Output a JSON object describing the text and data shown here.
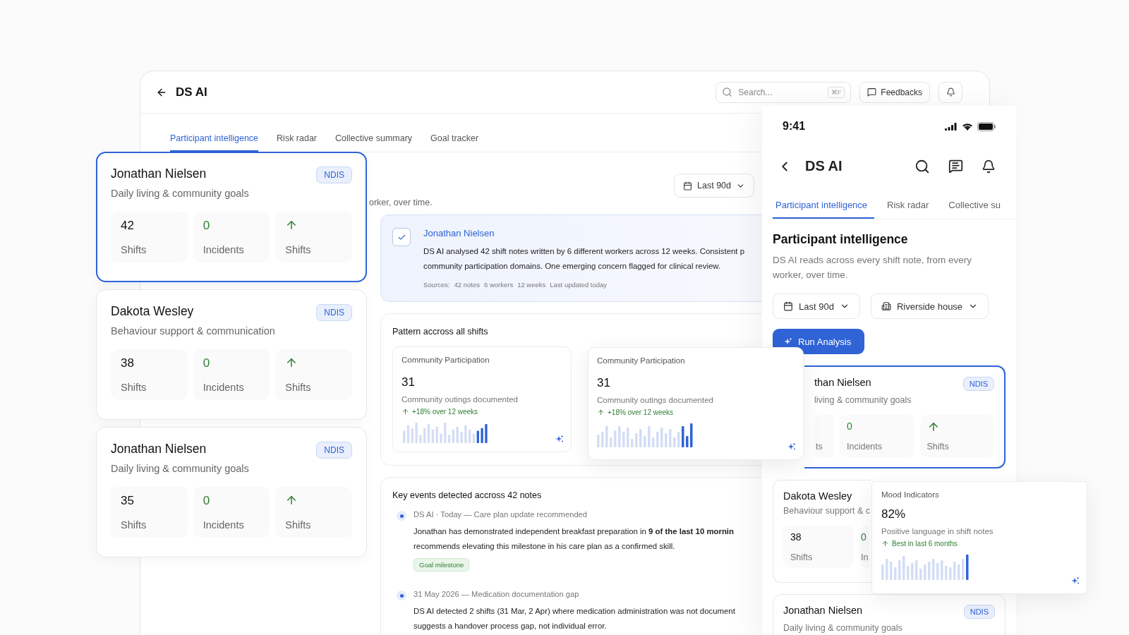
{
  "window": {
    "title": "DS AI",
    "search": {
      "placeholder": "Search...",
      "shortcut": "⌘F"
    },
    "feedback_button": "Feedbacks"
  },
  "tabs": [
    {
      "label": "Participant intelligence",
      "selected": true
    },
    {
      "label": "Risk radar",
      "selected": false
    },
    {
      "label": "Collective summary",
      "selected": false
    },
    {
      "label": "Goal tracker",
      "selected": false
    }
  ],
  "description_fragment": "orker, over time.",
  "period_filter": "Last 90d",
  "summary": {
    "checked": true,
    "name": "Jonathan Nielsen",
    "lines": [
      "DS AI analysed 42 shift notes written by 6 different workers across 12 weeks. Consistent p",
      "community participation domains. One emerging concern flagged for clinical review."
    ],
    "sources": [
      "Sources:",
      "42 notes",
      "6 workers",
      "12 weeks",
      "Last updated today"
    ]
  },
  "pattern": {
    "title": "Pattern accross all shifts",
    "cards": [
      {
        "title": "Community Participation",
        "value": "31",
        "caption": "Community outings documented",
        "trend": "+18% over 12 weeks"
      },
      {
        "title": "Community Participation",
        "value": "31",
        "caption": "Community outings documented",
        "trend": "+18% over 12 weeks"
      }
    ]
  },
  "key_events": {
    "title": "Key events detected accross 42 notes",
    "events": [
      {
        "meta": "DS AI · Today — Care plan update recommended",
        "lines": [
          "Jonathan has demonstrated independent breakfast preparation in **9 of the last 10 mornin**",
          "recommends elevating this milestone in his care plan as a confirmed skill."
        ],
        "tag": "Goal milestone"
      },
      {
        "meta": "31 May 2026 — Medication documentation gap",
        "lines": [
          "DS AI detected 2 shifts (31 Mar, 2 Apr) where medication administration was not document",
          "suggests a handover process gap, not individual error."
        ]
      }
    ]
  },
  "participant_cards": [
    {
      "name": "Jonathan Nielsen",
      "goal": "Daily living & community goals",
      "badge": "NDIS",
      "selected": true,
      "stats": [
        {
          "kind": "count",
          "value": "42",
          "label": "Shifts"
        },
        {
          "kind": "incidents",
          "value": "0",
          "label": "Incidents"
        },
        {
          "kind": "trend",
          "label": "Shifts"
        }
      ]
    },
    {
      "name": "Dakota Wesley",
      "goal": "Behaviour support & communication",
      "badge": "NDIS",
      "selected": false,
      "stats": [
        {
          "kind": "count",
          "value": "38",
          "label": "Shifts"
        },
        {
          "kind": "incidents",
          "value": "0",
          "label": "Incidents"
        },
        {
          "kind": "trend",
          "label": "Shifts"
        }
      ]
    },
    {
      "name": "Jonathan Nielsen",
      "goal": "Daily living & community goals",
      "badge": "NDIS",
      "selected": false,
      "stats": [
        {
          "kind": "count",
          "value": "35",
          "label": "Shifts"
        },
        {
          "kind": "incidents",
          "value": "0",
          "label": "Incidents"
        },
        {
          "kind": "trend",
          "label": "Shifts"
        }
      ]
    }
  ],
  "phone": {
    "time": "9:41",
    "title": "DS AI",
    "tabs": [
      {
        "label": "Participant intelligence",
        "selected": true
      },
      {
        "label": "Risk radar",
        "selected": false
      },
      {
        "label": "Collective su",
        "selected": false
      }
    ],
    "heading": "Participant intelligence",
    "description": "DS AI reads across every shift note, from every worker, over time.",
    "filters": [
      {
        "kind": "period",
        "label": "Last 90d"
      },
      {
        "kind": "location",
        "label": "Riverside house"
      }
    ],
    "run_button": "Run Analysis",
    "cards": [
      {
        "name": "than Nielsen",
        "goal": "living & community goals",
        "badge": "NDIS",
        "selected": true,
        "stats": [
          {
            "kind": "count",
            "label": "ts"
          },
          {
            "kind": "incidents",
            "value": "0",
            "label": "Incidents"
          },
          {
            "kind": "trend",
            "label": "Shifts"
          }
        ]
      },
      {
        "name": "Dakota Wesley",
        "goal": "Behaviour support & c",
        "selected": false,
        "stats": [
          {
            "kind": "count",
            "value": "38",
            "label": "Shifts"
          },
          {
            "kind": "incidents",
            "value": "0",
            "label": "In"
          }
        ]
      },
      {
        "name": "Jonathan Nielsen",
        "goal": "Daily living & community goals",
        "badge": "NDIS",
        "selected": false
      }
    ]
  },
  "mood_card": {
    "title": "Mood Indicators",
    "value": "82%",
    "caption": "Positive language in shift notes",
    "trend": "Best in last 6 months"
  }
}
